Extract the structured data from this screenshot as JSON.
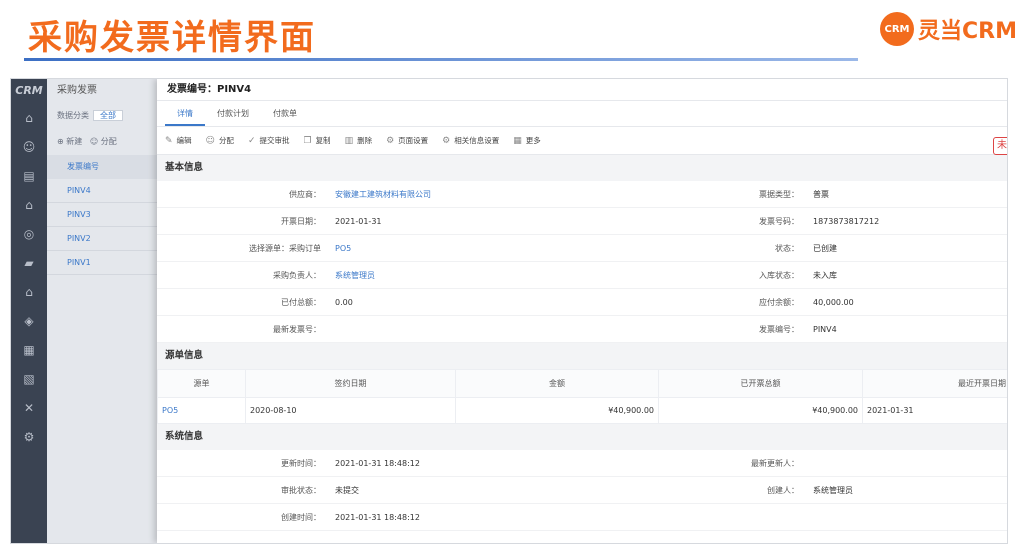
{
  "banner": {
    "title": "采购发票详情界面",
    "brand_logo": "CRM",
    "brand_name": "灵当CRM"
  },
  "rail": {
    "logo": "CRM",
    "icons": [
      "home-icon",
      "contacts-icon",
      "document-icon",
      "warehouse-icon",
      "target-icon",
      "truck-icon",
      "house-icon",
      "shield-icon",
      "report-icon",
      "chart-icon",
      "tools-icon",
      "settings-icon"
    ]
  },
  "list_panel": {
    "title": "采购发票",
    "filter_label": "数据分类",
    "filter_value": "全部",
    "new_label": "新建",
    "assign_label": "分配",
    "header": "发票编号",
    "rows": [
      "PINV4",
      "PINV3",
      "PINV2",
      "PINV1"
    ]
  },
  "detail": {
    "title": "发票编号：PINV4",
    "tabs": [
      "详情",
      "付款计划",
      "付款单"
    ],
    "toolbar": [
      "编辑",
      "分配",
      "提交审批",
      "复制",
      "删除",
      "页面设置",
      "相关信息设置",
      "更多"
    ],
    "stamp": "未",
    "basic": {
      "section": "基本信息",
      "rows": [
        {
          "l1": "供应商：",
          "v1": "安徽建工建筑材料有限公司",
          "l2": "票据类型：",
          "v2": "普票"
        },
        {
          "l1": "开票日期：",
          "v1": "2021-01-31",
          "l2": "发票号码：",
          "v2": "1873873817212"
        },
        {
          "l1": "选择源单：采购订单",
          "v1": "PO5",
          "l2": "状态：",
          "v2": "已创建"
        },
        {
          "l1": "采购负责人：",
          "v1": "系统管理员",
          "l2": "入库状态：",
          "v2": "未入库"
        },
        {
          "l1": "已付总额：",
          "v1": "0.00",
          "l2": "应付余额：",
          "v2": "40,000.00"
        },
        {
          "l1": "最新发票号：",
          "v1": "",
          "l2": "发票编号：",
          "v2": "PINV4"
        }
      ]
    },
    "source": {
      "section": "源单信息",
      "headers": [
        "源单",
        "签约日期",
        "金额",
        "已开票总额",
        "最近开票日期"
      ],
      "rows": [
        {
          "c1": "PO5",
          "c2": "2020-08-10",
          "c3": "¥40,900.00",
          "c4": "¥40,900.00",
          "c5": "2021-01-31"
        }
      ]
    },
    "system": {
      "section": "系统信息",
      "rows": [
        {
          "l1": "更新时间：",
          "v1": "2021-01-31 18:48:12",
          "l2": "最新更新人：",
          "v2": ""
        },
        {
          "l1": "审批状态：",
          "v1": "未提交",
          "l2": "创建人：",
          "v2": "系统管理员"
        },
        {
          "l1": "创建时间：",
          "v1": "2021-01-31 18:48:12",
          "l2": "",
          "v2": ""
        }
      ]
    }
  }
}
